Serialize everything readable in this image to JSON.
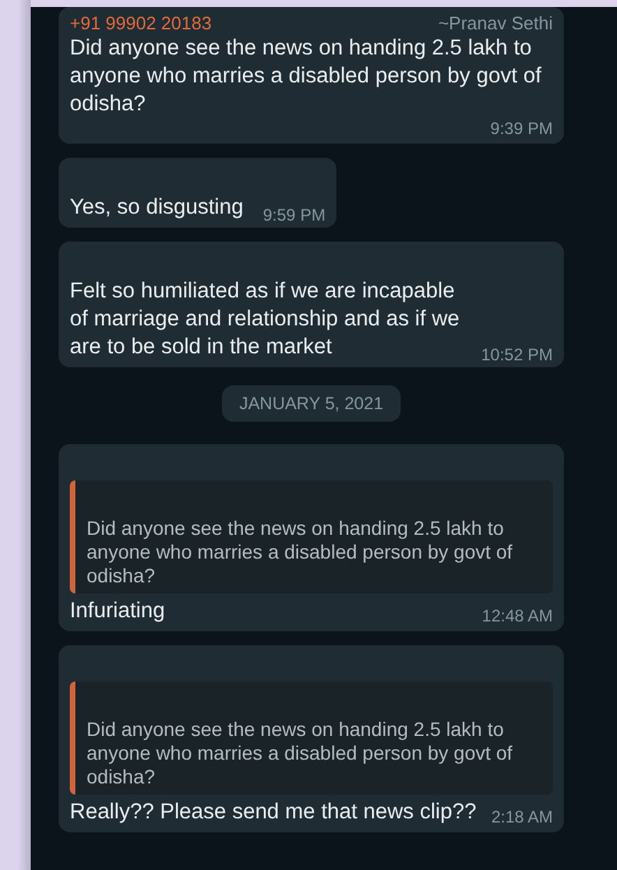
{
  "messages": [
    {
      "kind": "text",
      "sender": "+91 99902 20183",
      "sender_name": "~Pranav Sethi",
      "text": "Did anyone see the news on handing 2.5 lakh to anyone who marries a disabled person by govt of odisha?",
      "time": "9:39 PM"
    },
    {
      "kind": "text",
      "text": "Yes, so disgusting",
      "time": "9:59 PM"
    },
    {
      "kind": "text",
      "text": "Felt so humiliated as if we are incapable of marriage and relationship and as if we are to be sold in the market",
      "time": "10:52 PM"
    },
    {
      "kind": "date",
      "text": "JANUARY 5, 2021"
    },
    {
      "kind": "reply",
      "quote": "Did anyone see the news on handing 2.5 lakh to anyone who marries a disabled person by govt of odisha?",
      "text": "Infuriating",
      "time": "12:48 AM"
    },
    {
      "kind": "reply",
      "quote": "Did anyone see the news on handing 2.5 lakh to anyone who marries a disabled person by govt of odisha?",
      "text": "Really?? Please send me that news clip??",
      "time": "2:18 AM"
    }
  ]
}
